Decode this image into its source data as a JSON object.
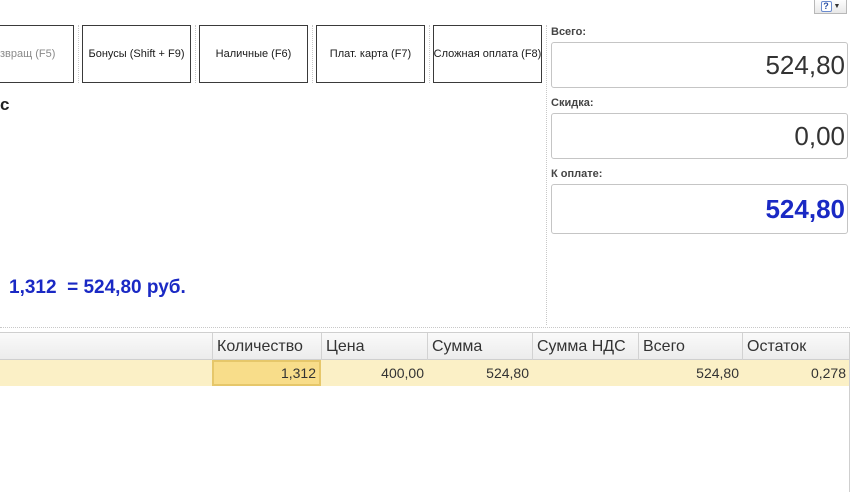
{
  "toolbar": {
    "return_label": "звращ (F5)",
    "bonus_label": "Бонусы (Shift + F9)",
    "cash_label": "Наличные (F6)",
    "card_label": "Плат. карта (F7)",
    "complex_label": "Сложная оплата (F8)"
  },
  "help": {
    "icon": "question-icon",
    "symbol": "?"
  },
  "left": {
    "title_fragment": "с",
    "calc_line": "1,312  = 524,80 руб."
  },
  "totals": {
    "total_label": "Всего:",
    "total_value": "524,80",
    "discount_label": "Скидка:",
    "discount_value": "0,00",
    "topay_label": "К оплате:",
    "topay_value": "524,80",
    "topay_color": "#1a29c4"
  },
  "table": {
    "columns": [
      "Количество",
      "Цена",
      "Сумма",
      "Сумма НДС",
      "Всего",
      "Остаток"
    ],
    "rows": [
      [
        "1,312",
        "400,00",
        "524,80",
        "",
        "524,80",
        "0,278"
      ]
    ],
    "selected_row_color": "#fbf0c6"
  }
}
